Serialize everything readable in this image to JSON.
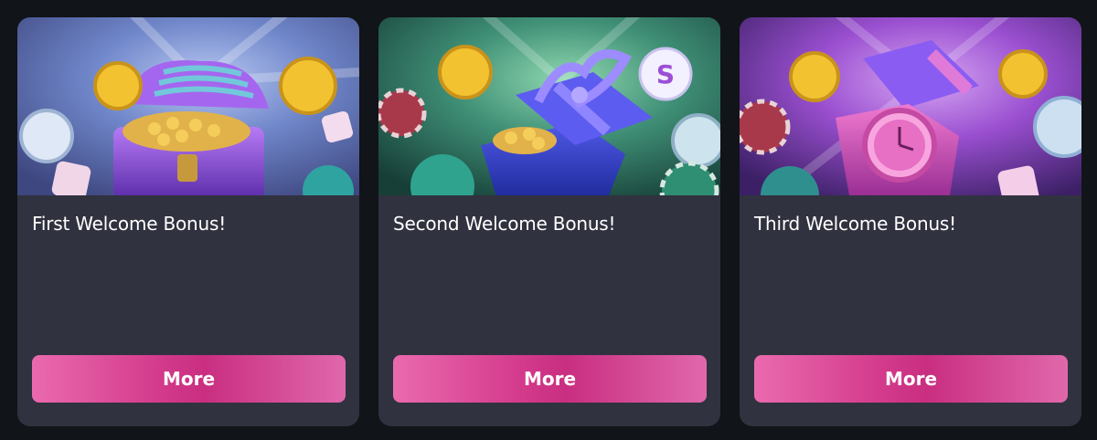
{
  "cards": [
    {
      "title": "First Welcome Bonus!",
      "button": "More",
      "theme": {
        "bg_top": "#6f86c9",
        "bg_bottom": "#4a4f8e",
        "accent": "#9b5cf0"
      }
    },
    {
      "title": "Second Welcome Bonus!",
      "button": "More",
      "theme": {
        "bg_top": "#3f8f76",
        "bg_bottom": "#1f5c4f",
        "accent": "#4d4ee0"
      }
    },
    {
      "title": "Third Welcome Bonus!",
      "button": "More",
      "theme": {
        "bg_top": "#9a4fd0",
        "bg_bottom": "#4a2a78",
        "accent": "#e04fb8"
      }
    }
  ],
  "colors": {
    "page_bg": "#111418",
    "card_bg": "#31323f",
    "button_pink": "#d43b8c",
    "coin_gold": "#f2c230"
  }
}
